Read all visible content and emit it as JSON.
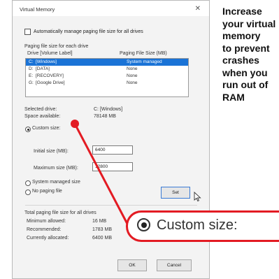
{
  "dialog": {
    "title": "Virtual Memory",
    "auto_manage_label": "Automatically manage paging file size for all drives",
    "auto_manage_checked": false,
    "section_label": "Paging file size for each drive",
    "columns": [
      "Drive [Volume Label]",
      "Paging File Size (MB)"
    ],
    "drives": [
      {
        "letter": "C:",
        "label": "[Windows]",
        "size": "System managed",
        "selected": true
      },
      {
        "letter": "D:",
        "label": "[DATA]",
        "size": "None",
        "selected": false
      },
      {
        "letter": "E:",
        "label": "[RECOVERY]",
        "size": "None",
        "selected": false
      },
      {
        "letter": "G:",
        "label": "[Google Drive]",
        "size": "None",
        "selected": false
      }
    ],
    "selected_drive_label": "Selected drive:",
    "selected_drive_value": "C:  [Windows]",
    "space_available_label": "Space available:",
    "space_available_value": "78148 MB",
    "custom_size_label": "Custom size:",
    "initial_size_label": "Initial size (MB):",
    "initial_size_value": "6400",
    "maximum_size_label": "Maximum size (MB):",
    "maximum_size_value": "12800",
    "system_managed_label": "System managed size",
    "no_paging_label": "No paging file",
    "set_button": "Set",
    "total_label": "Total paging file size for all drives",
    "min_label": "Minimum allowed:",
    "min_value": "16 MB",
    "recommended_label": "Recommended:",
    "recommended_value": "1783 MB",
    "allocated_label": "Currently allocated:",
    "allocated_value": "6400 MB",
    "ok_button": "OK",
    "cancel_button": "Cancel"
  },
  "callout": {
    "text": "Custom size:",
    "accent_color": "#e31b23"
  },
  "headline": {
    "lines": [
      "Increase",
      "your virtual",
      "memory",
      "to prevent",
      "crashes",
      "when you",
      "run out of",
      "RAM"
    ]
  }
}
